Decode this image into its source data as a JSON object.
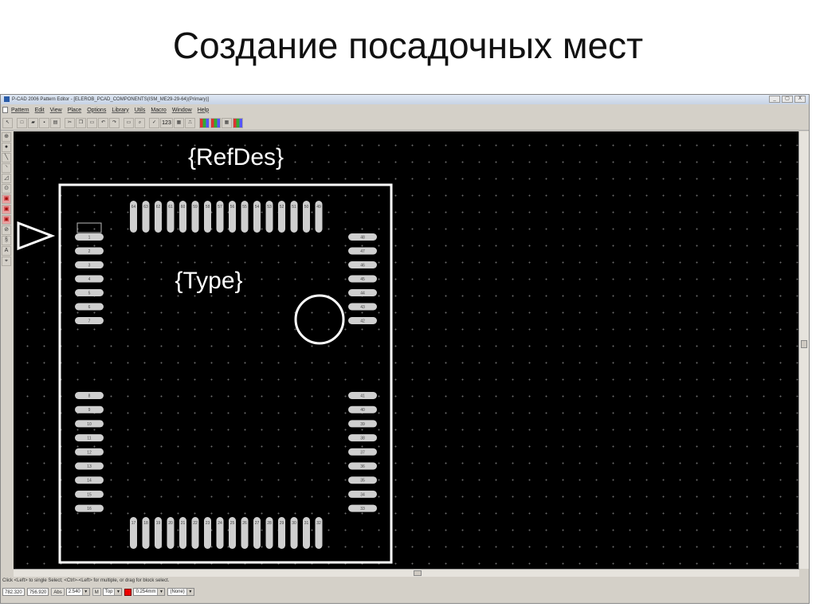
{
  "slide": {
    "title": "Создание посадочных мест"
  },
  "window": {
    "title": "P-CAD 2006 Pattern Editor - [ELEROB_PCAD_COMPONENTS(ISM_ME29-29-64)(Primary)]",
    "buttons": [
      "_",
      "▢",
      "X"
    ]
  },
  "menu": [
    "Pattern",
    "Edit",
    "View",
    "Place",
    "Options",
    "Library",
    "Utils",
    "Macro",
    "Window",
    "Help"
  ],
  "toolbar": {
    "num_label": "123"
  },
  "footprint": {
    "refdes_label": "{RefDes}",
    "type_label": "{Type}",
    "top_pins": [
      "64",
      "63",
      "62",
      "61",
      "60",
      "59",
      "58",
      "57",
      "56",
      "55",
      "54",
      "53",
      "52",
      "51",
      "50",
      "49"
    ],
    "bottom_pins": [
      "17",
      "18",
      "19",
      "20",
      "21",
      "22",
      "23",
      "24",
      "25",
      "26",
      "27",
      "28",
      "29",
      "30",
      "31",
      "32"
    ],
    "left_upper_pins": [
      "1",
      "2",
      "3",
      "4",
      "5",
      "6",
      "7"
    ],
    "left_lower_pins": [
      "8",
      "9",
      "10",
      "11",
      "12",
      "13",
      "14",
      "15",
      "16"
    ],
    "right_upper_pins": [
      "48",
      "47",
      "46",
      "45",
      "44",
      "43",
      "42"
    ],
    "right_lower_pins": [
      "41",
      "40",
      "39",
      "38",
      "37",
      "36",
      "35",
      "34",
      "33"
    ]
  },
  "status": {
    "message": "Click <Left> to single Select; <Ctrl>-<Left> for multiple, or drag for block select."
  },
  "bottom": {
    "x_coord": "782.320",
    "y_coord": "756.920",
    "abs_label": "Abs",
    "grid_value": "2.540",
    "m_label": "M",
    "layer": "Top",
    "line_width": "0.254mm",
    "net": "(None)"
  },
  "colors": {
    "canvas": "#000000",
    "silk": "#ffffff",
    "pad": "#cfcfcf",
    "pad_text": "#444444"
  }
}
